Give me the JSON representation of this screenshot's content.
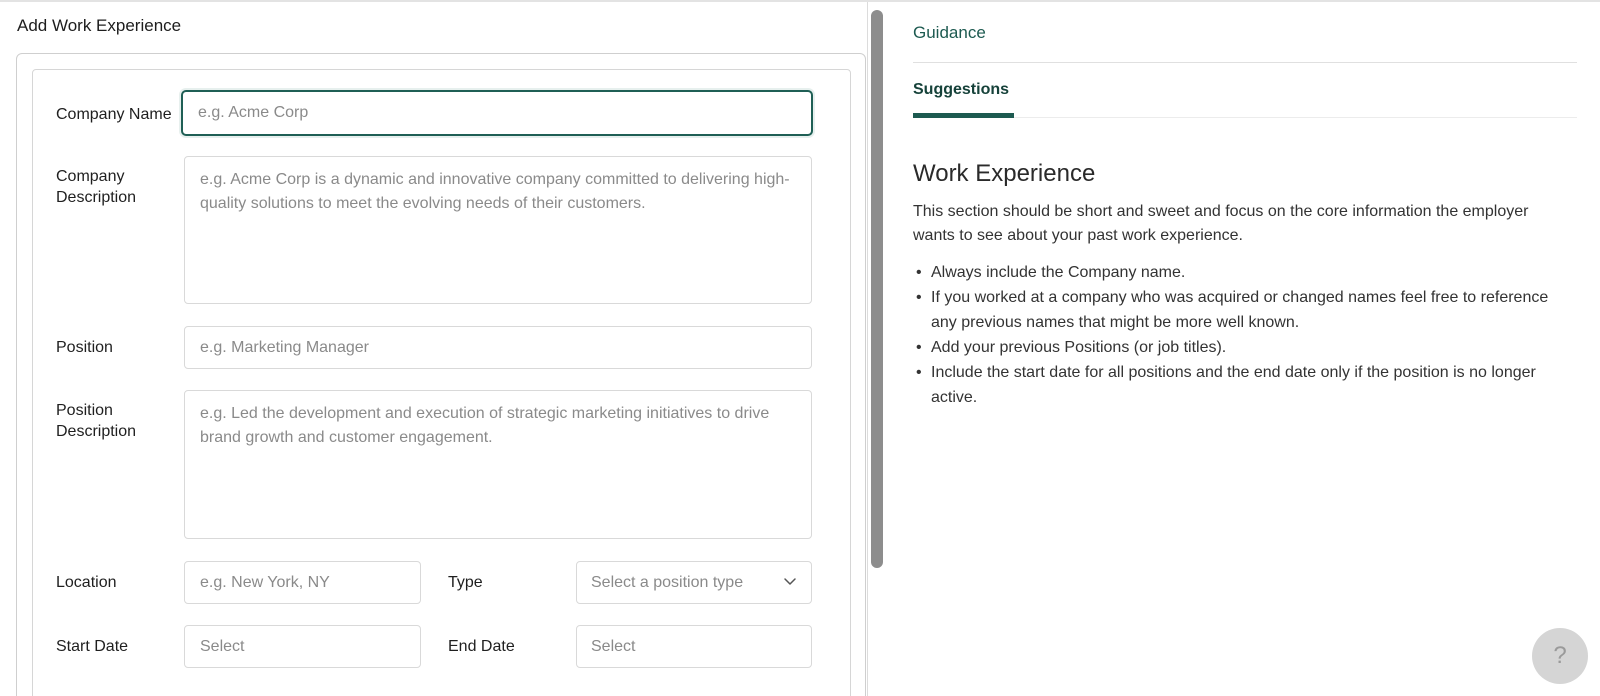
{
  "form": {
    "title": "Add Work Experience",
    "company_name": {
      "label": "Company Name",
      "placeholder": "e.g. Acme Corp"
    },
    "company_description": {
      "label_line1": "Company",
      "label_line2": "Description",
      "placeholder": "e.g. Acme Corp is a dynamic and innovative company committed to delivering high-quality solutions to meet the evolving needs of their customers."
    },
    "position": {
      "label": "Position",
      "placeholder": "e.g. Marketing Manager"
    },
    "position_description": {
      "label_line1": "Position",
      "label_line2": "Description",
      "placeholder": "e.g. Led the development and execution of strategic marketing initiatives to drive brand growth and customer engagement."
    },
    "location": {
      "label": "Location",
      "placeholder": "e.g. New York, NY"
    },
    "type": {
      "label": "Type",
      "placeholder": "Select a position type"
    },
    "start_date": {
      "label": "Start Date",
      "placeholder": "Select"
    },
    "end_date": {
      "label": "End Date",
      "placeholder": "Select"
    }
  },
  "guidance": {
    "tab_guidance": "Guidance",
    "tab_suggestions": "Suggestions",
    "section_title": "Work Experience",
    "section_description": "This section should be short and sweet and focus on the core information the employer wants to see about your past work experience.",
    "tips": [
      "Always include the Company name.",
      "If you worked at a company who was acquired or changed names feel free to reference any previous names that might be more well known.",
      "Add your previous Positions (or job titles).",
      "Include the start date for all positions and the end date only if the position is no longer active."
    ]
  },
  "help": {
    "label": "?"
  },
  "icons": {
    "type_dropdown": "chevron-down-icon"
  },
  "colors": {
    "accent": "#1d5a50",
    "focus_border": "#1f5f55"
  }
}
